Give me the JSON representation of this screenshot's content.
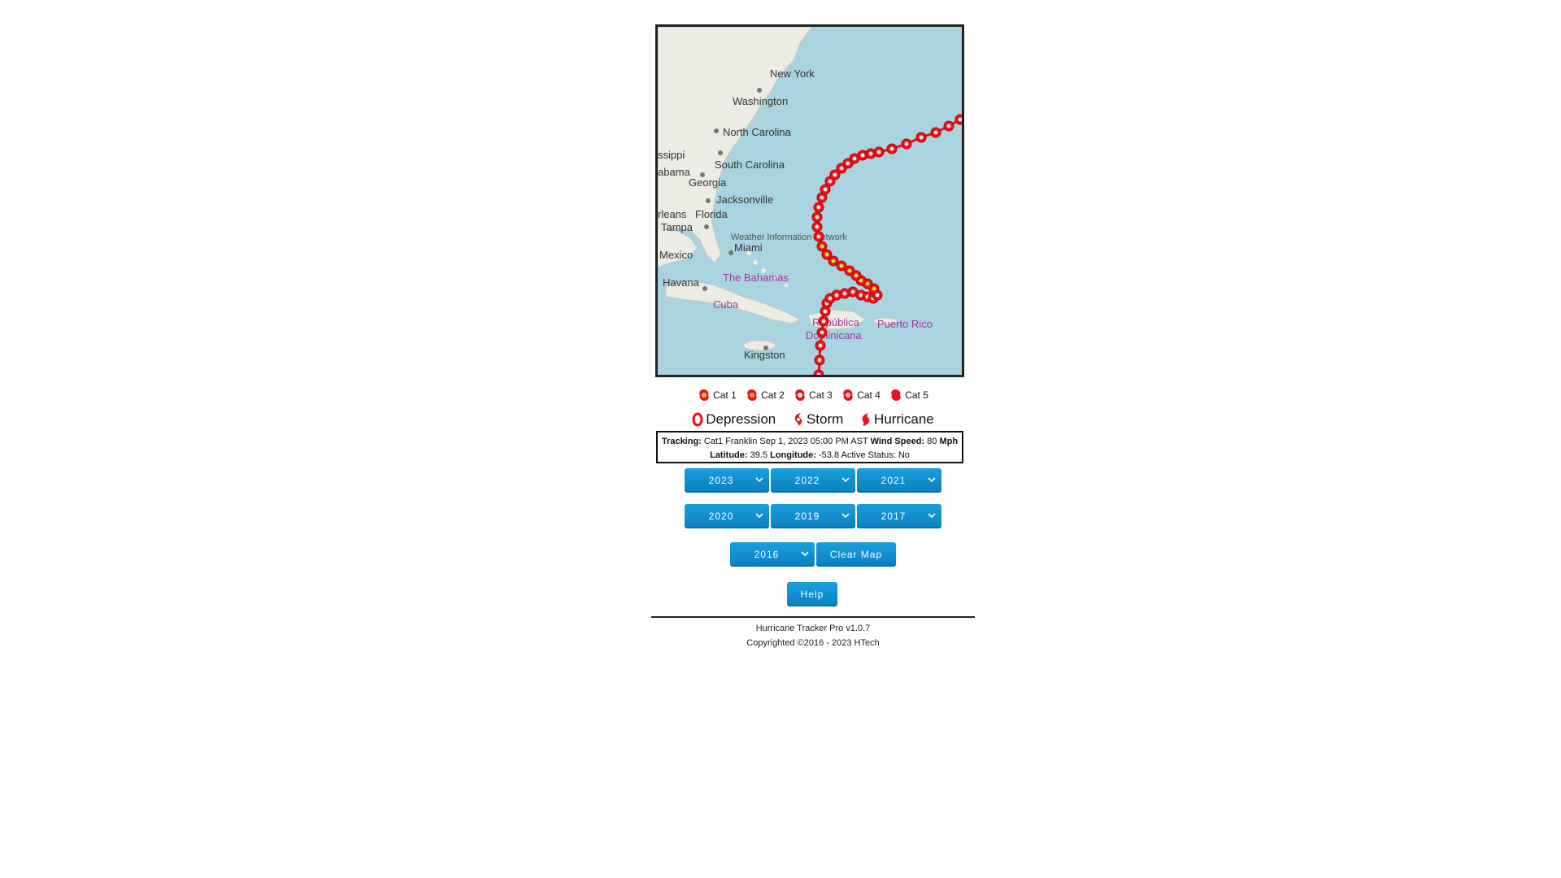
{
  "map": {
    "labels": {
      "new_york": "New York",
      "washington": "Washington",
      "north_carolina": "North Carolina",
      "mississippi": "ssippi",
      "south_carolina": "South Carolina",
      "alabama": "abama",
      "georgia": "Georgia",
      "jacksonville": "Jacksonville",
      "new_orleans": "rleans",
      "florida": "Florida",
      "tampa": "Tampa",
      "weather_network": "Weather Information Network",
      "miami": "Miami",
      "mexico": "Mexico",
      "bahamas": "The Bahamas",
      "havana": "Havana",
      "cuba": "Cuba",
      "republica": "República",
      "dominicana": "Dominicana",
      "puerto_rico": "Puerto Rico",
      "kingston": "Kingston"
    },
    "colors": {
      "ocean": "#a9d3df",
      "land": "#ecebe4",
      "track": "#e8141b",
      "marker_center": "#f5e23a"
    }
  },
  "legend": {
    "categories": [
      "Cat 1",
      "Cat 2",
      "Cat 3",
      "Cat 4",
      "Cat 5"
    ],
    "types": [
      "Depression",
      "Storm",
      "Hurricane"
    ]
  },
  "tracking": {
    "tracking_label": "Tracking:",
    "tracking_value": "Cat1 Franklin Sep 1, 2023 05:00 PM AST",
    "wind_label": "Wind Speed:",
    "wind_value": "80",
    "wind_unit": "Mph",
    "lat_label": "Latitude:",
    "lat_value": "39.5",
    "lon_label": "Longitude:",
    "lon_value": "-53.8",
    "active_text": "Active Status: No"
  },
  "year_selects": [
    "2023",
    "2022",
    "2021",
    "2020",
    "2019",
    "2017",
    "2016"
  ],
  "buttons": {
    "clear_map": "Clear Map",
    "help": "Help"
  },
  "footer": {
    "version": "Hurricane Tracker Pro v1.0.7",
    "copyright": "Copyrighted ©2016 - 2023 HTech"
  },
  "colors": {
    "button": "#1190d0",
    "border": "#222222"
  }
}
